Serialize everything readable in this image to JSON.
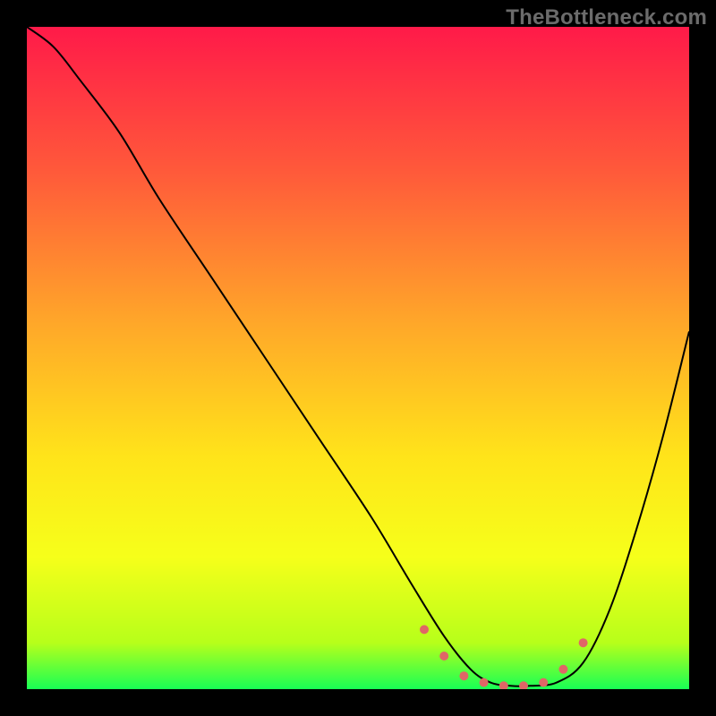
{
  "watermark": "TheBottleneck.com",
  "overlay_color": "#e06666",
  "chart_data": {
    "type": "line",
    "title": "",
    "xlabel": "",
    "ylabel": "",
    "xlim": [
      0,
      100
    ],
    "ylim": [
      0,
      100
    ],
    "grid": false,
    "legend": false,
    "background_gradient_stops": [
      {
        "offset": 0.0,
        "color": "#ff1a49"
      },
      {
        "offset": 0.22,
        "color": "#ff5a3a"
      },
      {
        "offset": 0.45,
        "color": "#ffa829"
      },
      {
        "offset": 0.65,
        "color": "#ffe41a"
      },
      {
        "offset": 0.8,
        "color": "#f6ff1a"
      },
      {
        "offset": 0.93,
        "color": "#b7ff1a"
      },
      {
        "offset": 1.0,
        "color": "#18ff55"
      }
    ],
    "series": [
      {
        "name": "bottleneck-curve",
        "x": [
          0,
          4,
          8,
          14,
          20,
          28,
          36,
          44,
          52,
          58,
          63,
          67,
          70,
          73,
          76,
          80,
          84,
          88,
          92,
          96,
          100
        ],
        "y": [
          100,
          97,
          92,
          84,
          74,
          62,
          50,
          38,
          26,
          16,
          8,
          3,
          1,
          0.5,
          0.5,
          1,
          4,
          12,
          24,
          38,
          54
        ]
      }
    ],
    "highlight_band": {
      "name": "optimal-range",
      "x": [
        60,
        63,
        66,
        69,
        72,
        75,
        78,
        81,
        84
      ],
      "y": [
        9,
        5,
        2,
        1,
        0.5,
        0.5,
        1,
        3,
        7
      ]
    }
  }
}
